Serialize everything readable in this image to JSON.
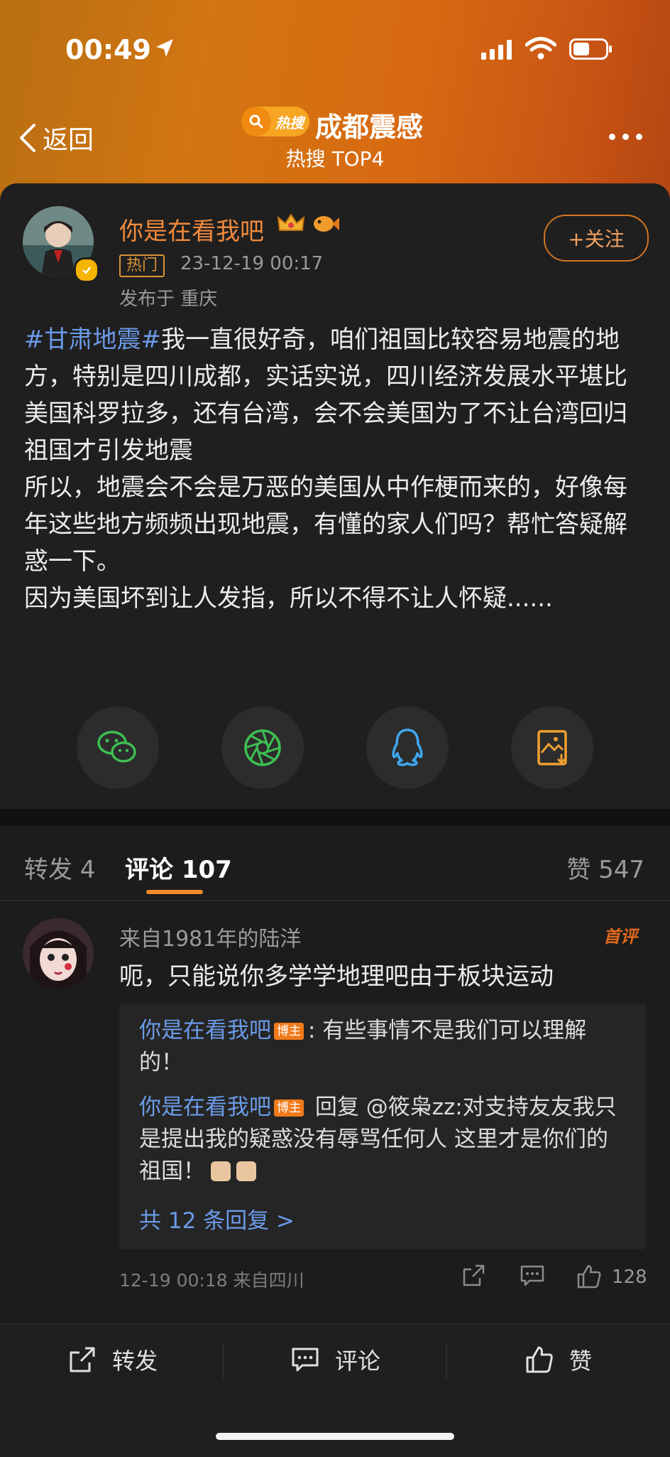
{
  "status_bar": {
    "time": "00:49"
  },
  "nav": {
    "back_label": "返回",
    "hot_badge": "热搜",
    "title": "成都震感",
    "subtitle": "热搜 TOP4"
  },
  "post": {
    "username": "你是在看我吧",
    "tag": "热门",
    "time": "23-12-19 00:17",
    "location": "发布于 重庆",
    "follow_label": "+关注",
    "hashtag": "#甘肃地震#",
    "lines": [
      "我一直很好奇，咱们祖国比较容易地震的地方，特别是四川成都，实话实说，四川经济发展水平堪比",
      "美国科罗拉多，还有台湾，会不会美国为了不让台湾回归祖国才引发地震",
      "所以，地震会不会是万恶的美国从中作梗而来的，好像每年这些地方频频出现地震，有懂的家人们吗？帮忙答疑解惑一下。",
      "因为美国坏到让人发指，所以不得不让人怀疑......"
    ],
    "share_icons": [
      "wechat-icon",
      "moments-icon",
      "qq-icon",
      "save-image-icon"
    ]
  },
  "tabs": {
    "repost": "转发 4",
    "comments": "评论 107",
    "likes": "赞 547"
  },
  "comment": {
    "user": "来自1981年的陆洋",
    "badge": "首评",
    "text": "呃，只能说你多学学地理吧由于板块运动",
    "replies": [
      {
        "name": "你是在看我吧",
        "role": "博主",
        "text": ": 有些事情不是我们可以理解的！"
      },
      {
        "name": "你是在看我吧",
        "role": "博主",
        "text": " 回复 @筱枭zz:对支持友友我只是提出我的疑惑没有辱骂任何人 这里才是你们的祖国！"
      }
    ],
    "more_replies": "共 12 条回复 >",
    "meta": "12-19 00:18  来自四川",
    "like_count": "128"
  },
  "bottom_bar": {
    "repost": "转发",
    "comment": "评论",
    "like": "赞"
  },
  "colors": {
    "accent": "#f08a2c",
    "link": "#6b9be8",
    "background": "#161616"
  }
}
